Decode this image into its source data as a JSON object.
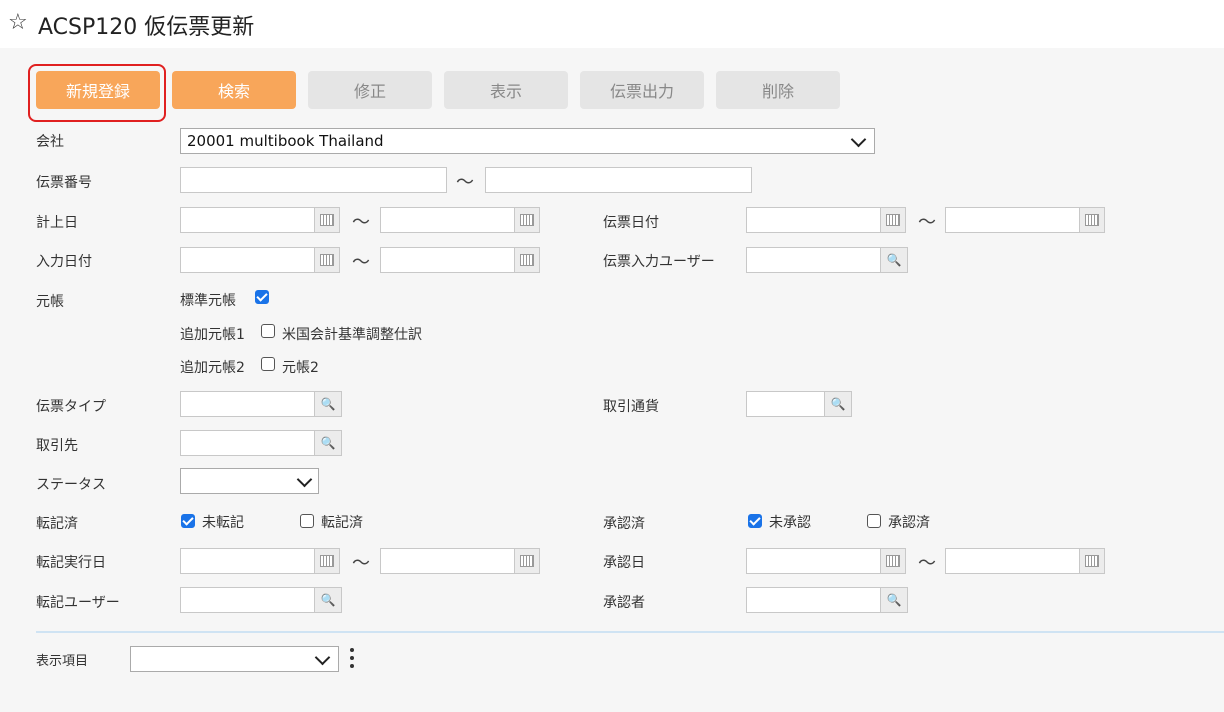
{
  "header": {
    "title": "ACSP120 仮伝票更新",
    "star_icon": "star-outline-icon"
  },
  "toolbar": {
    "new_label": "新規登録",
    "search_label": "検索",
    "edit_label": "修正",
    "view_label": "表示",
    "print_label": "伝票出力",
    "delete_label": "削除"
  },
  "form": {
    "company_label": "会社",
    "company_value": "20001 multibook Thailand",
    "voucher_no_label": "伝票番号",
    "posting_date_label": "計上日",
    "voucher_date_label": "伝票日付",
    "input_date_label": "入力日付",
    "input_user_label": "伝票入力ユーザー",
    "ledger_label": "元帳",
    "ledger_standard": "標準元帳",
    "ledger_additional1": "追加元帳1",
    "ledger_additional1_name": "米国会計基準調整仕訳",
    "ledger_additional2": "追加元帳2",
    "ledger_additional2_name": "元帳2",
    "voucher_type_label": "伝票タイプ",
    "currency_label": "取引通貨",
    "partner_label": "取引先",
    "status_label": "ステータス",
    "posted_label": "転記済",
    "unposted_option": "未転記",
    "posted_option": "転記済",
    "approved_label": "承認済",
    "unapproved_option": "未承認",
    "approved_option": "承認済",
    "posting_exec_date_label": "転記実行日",
    "approval_date_label": "承認日",
    "posting_user_label": "転記ユーザー",
    "approver_label": "承認者",
    "tilde": "～"
  },
  "footer": {
    "display_items_label": "表示項目"
  },
  "colors": {
    "accent_orange": "#f8a65a",
    "check_blue": "#1a73e8",
    "highlight_red": "#e02020"
  }
}
